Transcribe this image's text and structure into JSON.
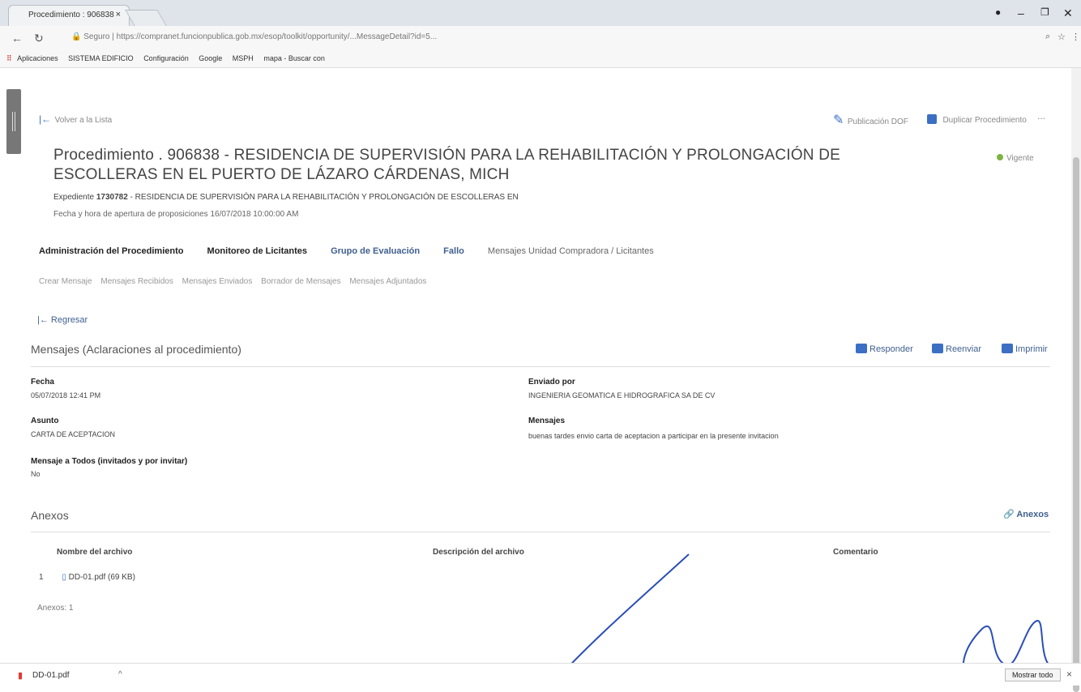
{
  "browser": {
    "tab_title": "Procedimiento : 906838",
    "tab_close": "×",
    "url_prefix": "Seguro",
    "url": "https://compranet.funcionpublica.gob.mx/esop/toolkit/opportunity/...MessageDetail?id=5...",
    "window_controls": {
      "minimize": "–",
      "maximize": "❐",
      "close": "✕"
    },
    "bookmarks": [
      "Aplicaciones",
      "SISTEMA EDIFICIO",
      "Configuración",
      "Google",
      "MSPH",
      "mapa - Buscar con"
    ]
  },
  "page": {
    "back_to_list": "Volver a la Lista",
    "publication_dof": "Publicación DOF",
    "duplicate_procedure": "Duplicar Procedimiento",
    "more": "...",
    "procedure_title": "Procedimiento . 906838 - RESIDENCIA DE SUPERVISIÓN PARA LA REHABILITACIÓN Y PROLONGACIÓN DE ESCOLLERAS EN EL PUERTO DE LÁZARO CÁRDENAS, MICH",
    "status": "Vigente",
    "expediente_label": "Expediente",
    "expediente_number": "1730782",
    "expediente_desc": "- RESIDENCIA DE SUPERVISIÓN PARA LA REHABILITACIÓN Y PROLONGACIÓN DE ESCOLLERAS EN",
    "apertura": "Fecha y hora de apertura de proposiciones  16/07/2018 10:00:00 AM",
    "tabs": [
      "Administración del Procedimiento",
      "Monitoreo de Licitantes",
      "Grupo de Evaluación",
      "Fallo",
      "Mensajes Unidad Compradora / Licitantes"
    ],
    "subtabs": [
      "Crear Mensaje",
      "Mensajes Recibidos",
      "Mensajes Enviados",
      "Borrador de Mensajes",
      "Mensajes Adjuntados"
    ],
    "regresar": "Regresar",
    "messages_heading": "Mensajes (Aclaraciones al procedimiento)",
    "actions": {
      "reply": "Responder",
      "forward": "Reenviar",
      "print": "Imprimir"
    },
    "fields": {
      "fecha_label": "Fecha",
      "fecha_value": "05/07/2018 12:41 PM",
      "enviado_label": "Enviado por",
      "enviado_value": "INGENIERIA GEOMATICA E HIDROGRAFICA SA DE CV",
      "asunto_label": "Asunto",
      "asunto_value": "CARTA DE ACEPTACION",
      "mensajes_label": "Mensajes",
      "mensajes_value": "buenas tardes envio carta de aceptacion a participar en la presente invitacion",
      "todos_label": "Mensaje a Todos (invitados y por invitar)",
      "todos_value": "No"
    },
    "anexos_heading": "Anexos",
    "anexos_button": "Anexos",
    "table_headers": [
      "Nombre del archivo",
      "Descripción del archivo",
      "Comentario"
    ],
    "rows": [
      {
        "index": "1",
        "file": "DD-01.pdf  (69 KB)"
      }
    ],
    "anexos_count": "Anexos: 1"
  },
  "downloads": {
    "file": "DD-01.pdf",
    "chevron": "^",
    "show_all": "Mostrar todo",
    "close": "×"
  }
}
